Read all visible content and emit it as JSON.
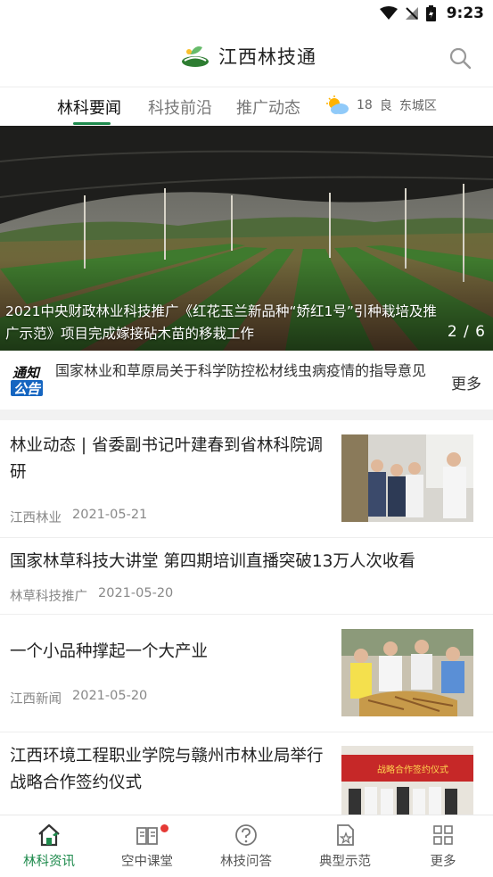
{
  "status_bar": {
    "time": "9:23"
  },
  "header": {
    "app_title": "江西林技通"
  },
  "tabs": [
    {
      "label": "林科要闻",
      "active": true
    },
    {
      "label": "科技前沿",
      "active": false
    },
    {
      "label": "推广动态",
      "active": false
    }
  ],
  "weather": {
    "temp": "18",
    "quality": "良",
    "district": "东城区"
  },
  "banner": {
    "caption": "2021中央财政林业科技推广《红花玉兰新品种“娇红1号”引种栽培及推广示范》项目完成嫁接砧木苗的移栽工作",
    "index": "2 / 6"
  },
  "notice": {
    "badge_line1": "通知",
    "badge_line2": "公告",
    "text": "国家林业和草原局关于科学防控松材线虫病疫情的指导意见",
    "more_label": "更多"
  },
  "news": [
    {
      "title": "林业动态 | 省委副书记叶建春到省林科院调研",
      "source": "江西林业",
      "date": "2021-05-21"
    },
    {
      "title": "国家林草科技大讲堂 第四期培训直播突破13万人次收看",
      "source": "林草科技推广",
      "date": "2021-05-20"
    },
    {
      "title": "一个小品种撑起一个大产业",
      "source": "江西新闻",
      "date": "2021-05-20"
    },
    {
      "title": "江西环境工程职业学院与赣州市林业局举行战略合作签约仪式"
    }
  ],
  "thumb_banner_text": "战略合作签约仪式",
  "bottom_nav": [
    {
      "label": "林科资讯",
      "active": true
    },
    {
      "label": "空中课堂",
      "active": false
    },
    {
      "label": "林技问答",
      "active": false
    },
    {
      "label": "典型示范",
      "active": false
    },
    {
      "label": "更多",
      "active": false
    }
  ],
  "colors": {
    "accent": "#1e8a4c",
    "badge_blue": "#1565c0",
    "dot_red": "#e53935"
  }
}
